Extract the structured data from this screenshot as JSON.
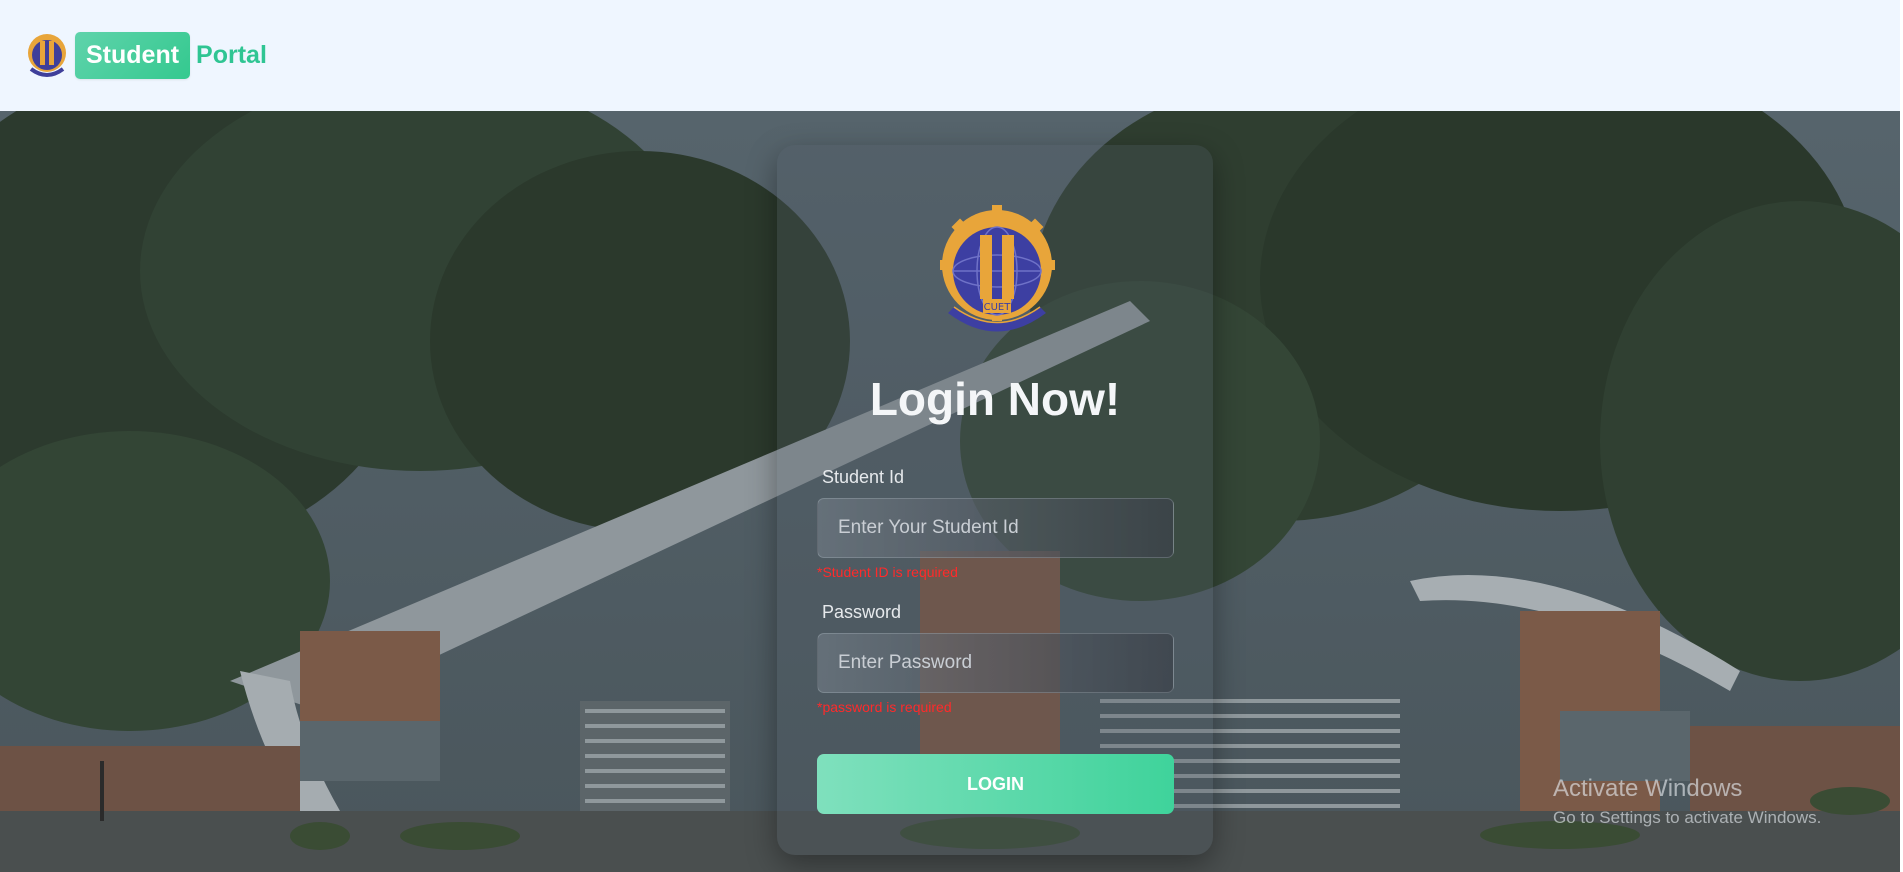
{
  "header": {
    "brand_highlight": "Student",
    "brand_rest": "Portal"
  },
  "login": {
    "title": "Login Now!",
    "student_id_label": "Student Id",
    "student_id_placeholder": "Enter Your Student Id",
    "student_id_error": "*Student ID is required",
    "password_label": "Password",
    "password_placeholder": "Enter Password",
    "password_error": "*password is required",
    "button_label": "LOGIN"
  },
  "watermark": {
    "title": "Activate Windows",
    "subtitle": "Go to Settings to activate Windows."
  },
  "colors": {
    "accent": "#34c98f",
    "header_bg": "#eff6ff",
    "error": "#ff2a2a"
  },
  "icons": {
    "logo": "cuet-logo-icon",
    "seal": "cuet-seal-icon"
  }
}
